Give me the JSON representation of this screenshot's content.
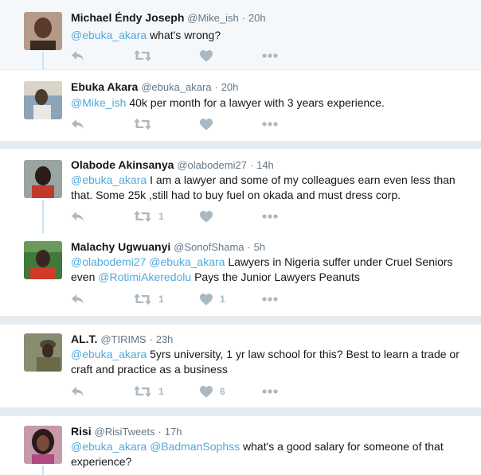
{
  "tweets": [
    {
      "name": "Michael Éndy Joseph",
      "handle": "@Mike_ish",
      "time": "20h",
      "mentions": [
        "@ebuka_akara"
      ],
      "text": "what's wrong?",
      "retweets": "",
      "likes": "",
      "avatar_colors": [
        "#b59a88",
        "#3a2a22"
      ]
    },
    {
      "name": "Ebuka Akara",
      "handle": "@ebuka_akara",
      "time": "20h",
      "mentions": [
        "@Mike_ish"
      ],
      "text": "40k per month for a lawyer with 3 years experience.",
      "retweets": "",
      "likes": "",
      "avatar_colors": [
        "#8da3b8",
        "#4a3a30"
      ]
    },
    {
      "name": "Olabode Akinsanya",
      "handle": "@olabodemi27",
      "time": "14h",
      "mentions": [
        "@ebuka_akara"
      ],
      "text": "I am a lawyer and some of my colleagues earn even less than that. Some 25k ,still had to buy fuel on okada and must dress corp.",
      "retweets": "1",
      "likes": "",
      "avatar_colors": [
        "#9aa4a0",
        "#2a1d18"
      ]
    },
    {
      "name": "Malachy Ugwuanyi",
      "handle": "@SonofShama",
      "time": "5h",
      "mentions": [
        "@olabodemi27",
        "@ebuka_akara"
      ],
      "text_a": "Lawyers in Nigeria suffer under Cruel Seniors even",
      "mention_mid": "@RotimiAkeredolu",
      "text_b": "Pays the Junior Lawyers Peanuts",
      "retweets": "1",
      "likes": "1",
      "avatar_colors": [
        "#3f7a3a",
        "#d23a2a"
      ]
    },
    {
      "name": "AL.T.",
      "handle": "@TIRIMS",
      "time": "23h",
      "mentions": [
        "@ebuka_akara"
      ],
      "text": "5yrs university, 1 yr law school for this? Best to learn a trade or craft and practice as a business",
      "retweets": "1",
      "likes": "6",
      "avatar_colors": [
        "#8a8c70",
        "#3c3a26"
      ]
    },
    {
      "name": "Risi",
      "handle": "@RisiTweets",
      "time": "17h",
      "mentions": [
        "@ebuka_akara",
        "@BadmanSophss"
      ],
      "text": "what's a good salary for someone of that experience?",
      "retweets": "",
      "likes": "",
      "avatar_colors": [
        "#c89aa8",
        "#2a1a1c"
      ]
    }
  ],
  "icons": {
    "reply": "reply-icon",
    "retweet": "retweet-icon",
    "like": "heart-icon",
    "more": "more-icon"
  },
  "colors": {
    "link": "#52a9dc",
    "action_gray": "#aab8c2",
    "thread_line": "#c4e3f5",
    "focused_bg": "#f5f8fa"
  }
}
